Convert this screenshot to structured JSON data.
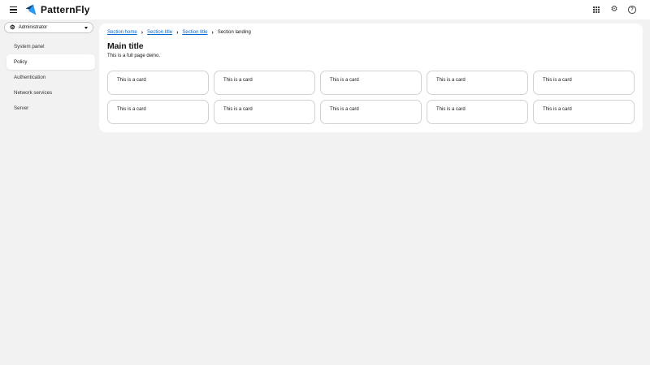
{
  "header": {
    "brand": "PatternFly"
  },
  "icons": {
    "gear_glyph": "⚙",
    "cogs_glyph": "⚙",
    "help_glyph": "?",
    "breadcrumb_separator": "›"
  },
  "sidebar": {
    "context_selector": {
      "label": "Administrator"
    },
    "items": [
      {
        "label": "System panel",
        "selected": false
      },
      {
        "label": "Policy",
        "selected": true
      },
      {
        "label": "Authentication",
        "selected": false
      },
      {
        "label": "Network services",
        "selected": false
      },
      {
        "label": "Server",
        "selected": false
      }
    ]
  },
  "breadcrumb": {
    "items": [
      {
        "label": "Section home",
        "link": true
      },
      {
        "label": "Section title",
        "link": true
      },
      {
        "label": "Section title",
        "link": true
      },
      {
        "label": "Section landing",
        "link": false,
        "current": true
      }
    ]
  },
  "main": {
    "title": "Main title",
    "subtitle": "This is a full page demo.",
    "cards": [
      "This is a card",
      "This is a card",
      "This is a card",
      "This is a card",
      "This is a card",
      "This is a card",
      "This is a card",
      "This is a card",
      "This is a card",
      "This is a card"
    ]
  },
  "colors": {
    "page_background": "#f2f2f2",
    "panel_background": "#ffffff",
    "link_blue": "#0066cc",
    "card_border": "#d2d2d2",
    "brand_blue_dark": "#123d6e",
    "brand_blue_light": "#2b9af3"
  }
}
